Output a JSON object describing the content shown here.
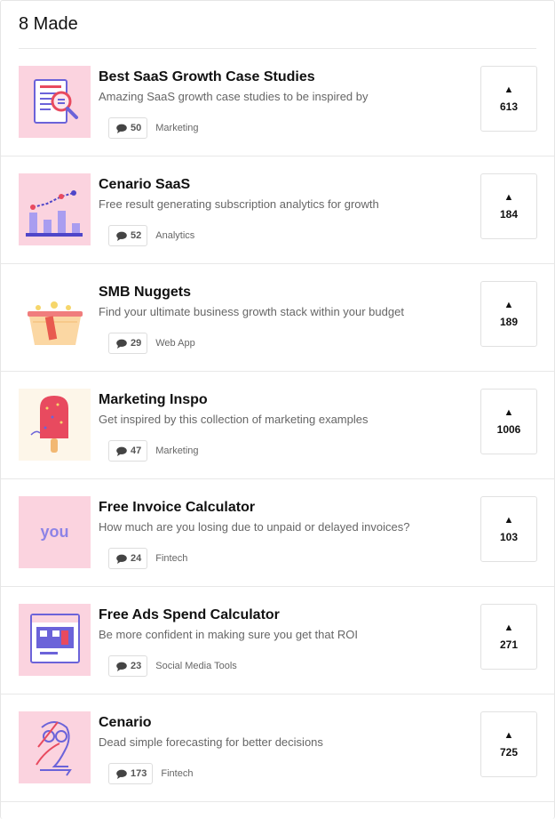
{
  "header": {
    "title": "8 Made"
  },
  "posts": [
    {
      "name": "Best SaaS Growth Case Studies",
      "tagline": "Amazing SaaS growth case studies to be inspired by",
      "comments": "50",
      "topic": "Marketing",
      "votes": "613",
      "icon": "document-magnifier-icon",
      "thumb_bg": "#fbd3df"
    },
    {
      "name": "Cenario SaaS",
      "tagline": "Free result generating subscription analytics for growth",
      "comments": "52",
      "topic": "Analytics",
      "votes": "184",
      "icon": "bar-chart-icon",
      "thumb_bg": "#fbd3df"
    },
    {
      "name": "SMB Nuggets",
      "tagline": "Find your ultimate business growth stack within your budget",
      "comments": "29",
      "topic": "Web App",
      "votes": "189",
      "icon": "treasure-chest-icon",
      "thumb_bg": "#ffffff"
    },
    {
      "name": "Marketing Inspo",
      "tagline": "Get inspired by this collection of marketing examples",
      "comments": "47",
      "topic": "Marketing",
      "votes": "1006",
      "icon": "popsicle-icon",
      "thumb_bg": "#fdf6e9"
    },
    {
      "name": "Free Invoice Calculator",
      "tagline": "How much are you losing due to unpaid or delayed invoices?",
      "comments": "24",
      "topic": "Fintech",
      "votes": "103",
      "icon": "you-text-logo",
      "logo_text": "you",
      "thumb_bg": "#fbd3df"
    },
    {
      "name": "Free Ads Spend Calculator",
      "tagline": "Be more confident in making sure you get that ROI",
      "comments": "23",
      "topic": "Social Media Tools",
      "votes": "271",
      "icon": "browser-window-icon",
      "thumb_bg": "#fbd3df"
    },
    {
      "name": "Cenario",
      "tagline": "Dead simple forecasting for better decisions",
      "comments": "173",
      "topic": "Fintech",
      "votes": "725",
      "icon": "owl-logo-icon",
      "thumb_bg": "#fbd3df"
    }
  ],
  "colors": {
    "accent_purple": "#6b63d9",
    "accent_red": "#e84a5f",
    "thumb_pink": "#fbd3df",
    "border": "#e6e6e6"
  }
}
